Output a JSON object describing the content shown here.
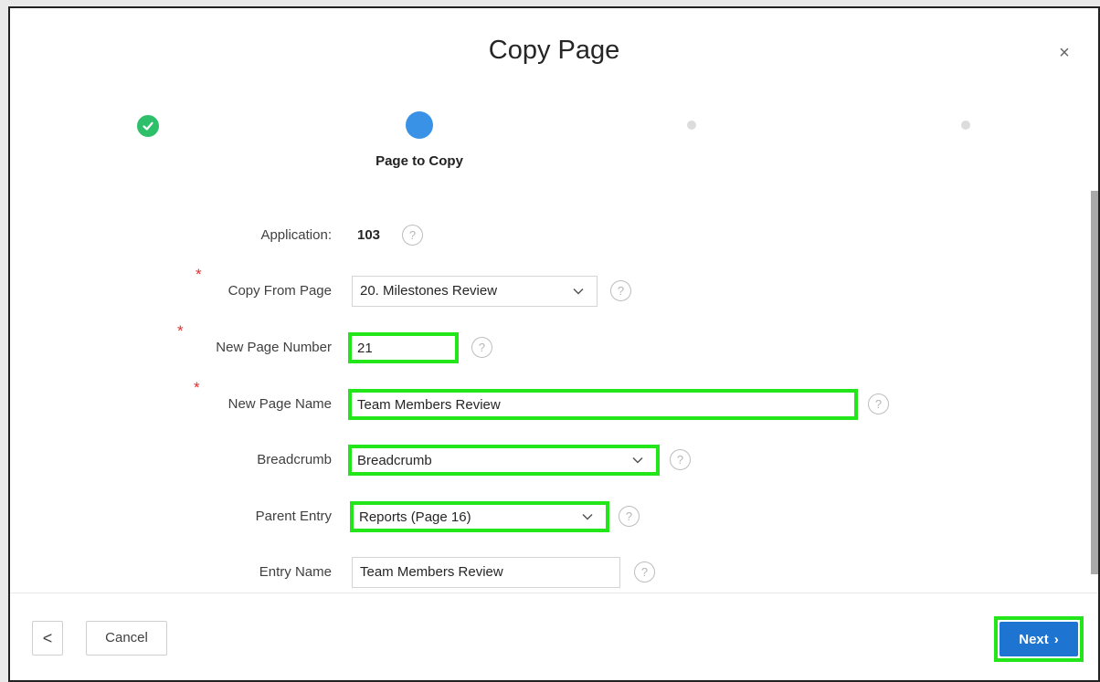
{
  "dialog": {
    "title": "Copy Page",
    "close_glyph": "×"
  },
  "wizard": {
    "steps": [
      {
        "state": "done",
        "icon": "check-icon"
      },
      {
        "state": "current",
        "label": "Page to Copy"
      },
      {
        "state": "future"
      },
      {
        "state": "future"
      }
    ]
  },
  "form": {
    "application": {
      "label": "Application:",
      "value": "103"
    },
    "copy_from_page": {
      "label": "Copy From Page",
      "value": "20. Milestones Review",
      "required": true
    },
    "new_page_number": {
      "label": "New Page Number",
      "value": "21",
      "required": true
    },
    "new_page_name": {
      "label": "New Page Name",
      "value": "Team Members Review",
      "required": true
    },
    "breadcrumb": {
      "label": "Breadcrumb",
      "value": "Breadcrumb"
    },
    "parent_entry": {
      "label": "Parent Entry",
      "value": "Reports (Page 16)"
    },
    "entry_name": {
      "label": "Entry Name",
      "value": "Team Members Review"
    },
    "help_glyph": "?",
    "required_glyph": "*"
  },
  "footer": {
    "prev_glyph": "<",
    "cancel_label": "Cancel",
    "next_label": "Next",
    "next_glyph": "›"
  },
  "colors": {
    "accent": "#1d74d1",
    "step_done": "#2ebf6b",
    "step_current": "#3a92e6",
    "highlight": "#22e61a",
    "required": "#e0302f"
  }
}
